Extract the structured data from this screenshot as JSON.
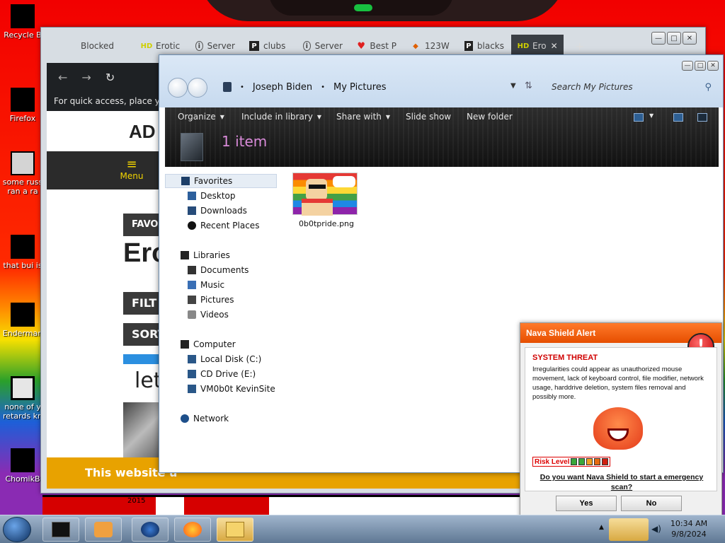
{
  "desktop": {
    "icons": [
      {
        "label": "Recycle B"
      },
      {
        "label": "Firefox"
      },
      {
        "label": "some russ ran a ra"
      },
      {
        "label": "that bui is"
      },
      {
        "label": "Enderman"
      },
      {
        "label": "none of y retards kn"
      },
      {
        "label": "ChomikB"
      }
    ],
    "wallpaper_year": "2015"
  },
  "browser": {
    "tabs": [
      {
        "label": "Blocked",
        "icon": ""
      },
      {
        "label": "Erotic",
        "icon": "HD"
      },
      {
        "label": "Server",
        "icon": "i"
      },
      {
        "label": "clubs",
        "icon": "P"
      },
      {
        "label": "Server",
        "icon": "i"
      },
      {
        "label": "Best P",
        "icon": "♥"
      },
      {
        "label": "123W",
        "icon": "◆"
      },
      {
        "label": "blacks",
        "icon": "P"
      },
      {
        "label": "Ero",
        "icon": "HD"
      }
    ],
    "active_tab_close": "✕",
    "new_tab": "+",
    "nav": {
      "back": "←",
      "forward": "→",
      "reload": "↻"
    },
    "bookmarks_hint": "For quick access, place your",
    "site": {
      "ad": "AD",
      "menu": "Menu",
      "menu_icon": "≡",
      "favor": "FAVOR",
      "ero": "Ero",
      "filt": "FILT",
      "sort": "SORT",
      "let": "let"
    },
    "cookie_text": "This website u"
  },
  "explorer": {
    "breadcrumb": [
      "Joseph Biden",
      "My Pictures"
    ],
    "breadcrumb_sep": "•",
    "search_placeholder": "Search My Pictures",
    "toolbar": {
      "organize": "Organize",
      "include": "Include in library",
      "share": "Share with",
      "slideshow": "Slide show",
      "newfolder": "New folder"
    },
    "item_count": "1 item",
    "nav": {
      "favorites": "Favorites",
      "desktop": "Desktop",
      "downloads": "Downloads",
      "recent": "Recent Places",
      "libraries": "Libraries",
      "documents": "Documents",
      "music": "Music",
      "pictures": "Pictures",
      "videos": "Videos",
      "computer": "Computer",
      "localdisk": "Local Disk (C:)",
      "cddrive": "CD Drive (E:)",
      "vm": "VM0b0t KevinSite",
      "network": "Network"
    },
    "files": [
      {
        "name": "0b0tpride.png"
      }
    ]
  },
  "nava": {
    "title": "Nava Shield Alert",
    "warn_glyph": "!",
    "threat": "SYSTEM THREAT",
    "description": "Irregularities could appear as unauthorized mouse movement, lack of keyboard control, file modifier, network usage, harddrive deletion, system files removal and possibly more.",
    "risk_label": "Risk Level",
    "risk_level": 5,
    "risk_colors": [
      "#3aa83a",
      "#3aa83a",
      "#f0a020",
      "#e66a10",
      "#d02010"
    ],
    "question": "Do you want Nava Shield to start a emergency scan?",
    "yes": "Yes",
    "no": "No"
  },
  "taskbar": {
    "time": "10:34 AM",
    "date": "9/8/2024",
    "tray_up": "▲",
    "volume": "◀)"
  },
  "colors": {
    "accent": "#e64e00",
    "threat": "#d00000",
    "explorer_count": "#d88ad8"
  }
}
